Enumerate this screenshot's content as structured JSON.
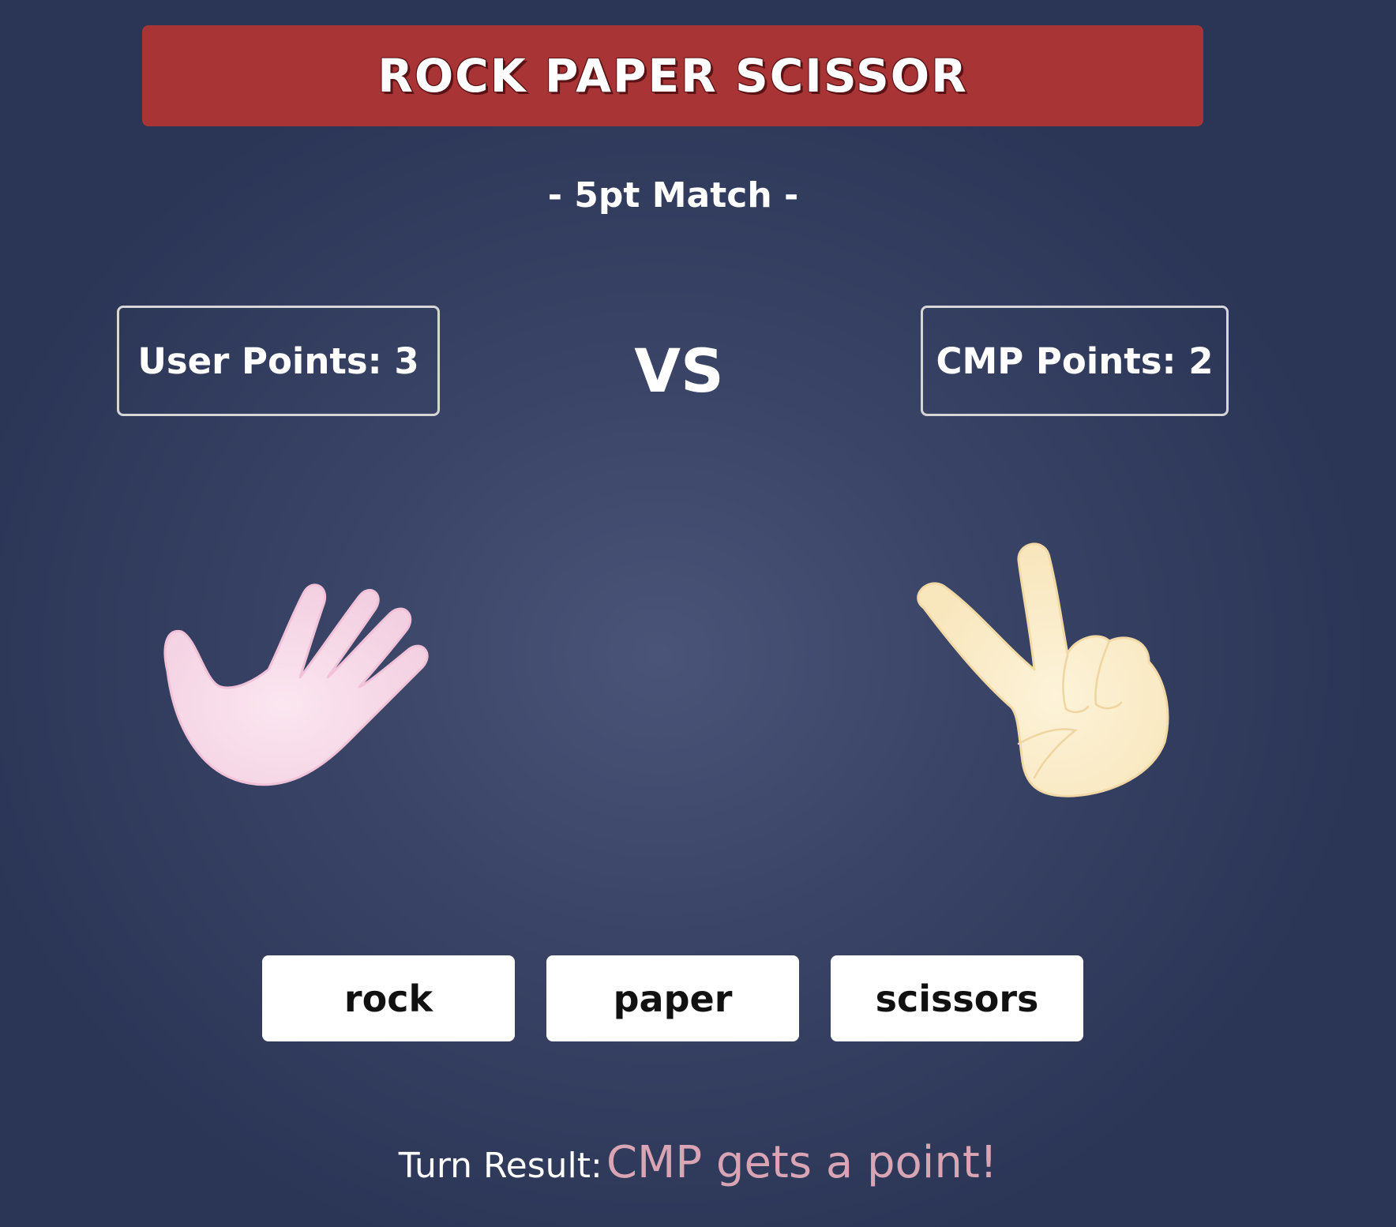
{
  "header": {
    "title": "ROCK PAPER SCISSOR"
  },
  "match": {
    "label": "- 5pt Match -"
  },
  "scores": {
    "user_label": "User Points: 3",
    "cmp_label": "CMP Points: 2",
    "vs": "VS"
  },
  "hands": {
    "user_choice": "paper",
    "cmp_choice": "scissors",
    "user_icon": "open-hand-paper-icon",
    "cmp_icon": "peace-sign-scissors-icon",
    "user_color": "#f6dbe8",
    "cmp_color": "#fbefcf"
  },
  "controls": {
    "rock": "rock",
    "paper": "paper",
    "scissors": "scissors"
  },
  "result": {
    "label": "Turn Result:",
    "value": "CMP gets a point!"
  },
  "colors": {
    "title_bar": "#a83436",
    "background": "#3a4466",
    "result_text": "#d9a5b4"
  }
}
